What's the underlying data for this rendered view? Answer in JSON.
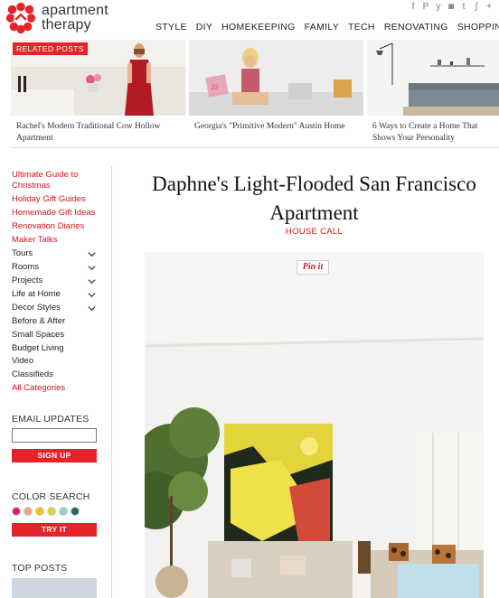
{
  "brand": {
    "line1": "apartment",
    "line2": "therapy",
    "color": "#e3242b"
  },
  "social_icons": [
    "facebook-icon",
    "pinterest-icon",
    "twitter-icon",
    "instagram-icon",
    "tumblr-icon",
    "rss-icon",
    "plus-icon"
  ],
  "social_glyphs": [
    "f",
    "P",
    "y",
    "◙",
    "t",
    "ʃ",
    "+"
  ],
  "nav": [
    "STYLE",
    "DIY",
    "HOMEKEEPING",
    "FAMILY",
    "TECH",
    "RENOVATING",
    "SHOPPING"
  ],
  "related": {
    "badge": "RELATED POSTS",
    "items": [
      {
        "caption": "Rachel's Modern Traditional Cow Hollow Apartment"
      },
      {
        "caption": "Georgia's \"Primitive Modern\" Austin Home"
      },
      {
        "caption": "6 Ways to Create a Home That Shows Your Personality"
      }
    ]
  },
  "sidebar": {
    "red_links": [
      "Ultimate Guide to Christmas",
      "Holiday Gift Guides",
      "Homemade Gift Ideas",
      "Renovation Diaries",
      "Maker Talks"
    ],
    "expand_links": [
      "Tours",
      "Rooms",
      "Projects",
      "Life at Home",
      "Decor Styles"
    ],
    "plain_links": [
      "Before & After",
      "Small Spaces",
      "Budget Living",
      "Video",
      "Classifieds"
    ],
    "all_categories": "All Categories",
    "email_heading": "EMAIL UPDATES",
    "signup": "SIGN UP",
    "color_heading": "COLOR SEARCH",
    "try_it": "TRY IT",
    "swatch_colors": [
      "#e0206a",
      "#f4a08a",
      "#f2c21a",
      "#d9d92a",
      "#8fd0c8",
      "#1d6a63"
    ],
    "top_posts": "TOP POSTS"
  },
  "article": {
    "title": "Daphne's Light-Flooded San Francisco Apartment",
    "category": "HOUSE CALL",
    "pin_label": "Pin it"
  }
}
